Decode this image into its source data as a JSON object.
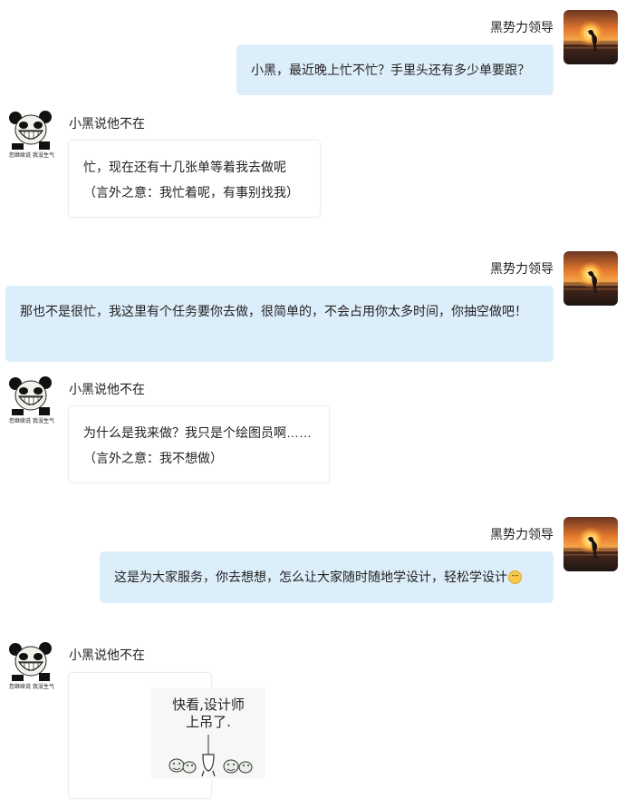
{
  "messages": [
    {
      "sender": "黑势力领导",
      "side": "right",
      "lines": [
        "小黑，最近晚上忙不忙？手里头还有多少单要跟？"
      ]
    },
    {
      "sender": "小黑说他不在",
      "side": "left",
      "lines": [
        "忙，现在还有十几张单等着我去做呢",
        "（言外之意：我忙着呢，有事别找我）"
      ]
    },
    {
      "sender": "黑势力领导",
      "side": "right",
      "text": "那也不是很忙，我这里有个任务要你去做，很简单的，不会占用你太多时间，你抽空做吧！"
    },
    {
      "sender": "小黑说他不在",
      "side": "left",
      "lines": [
        "为什么是我来做？我只是个绘图员啊……",
        "（言外之意：我不想做）"
      ]
    },
    {
      "sender": "黑势力领导",
      "side": "right",
      "text": "这是为大家服务，你去想想，怎么让大家随时随地学设计，轻松学设计",
      "emoji": "smile-emoji"
    },
    {
      "sender": "小黑说他不在",
      "side": "left",
      "sticker": {
        "line1": "快看,设计师",
        "line2": "上吊了."
      }
    }
  ],
  "avatars": {
    "leader": "sunset-heron-avatar",
    "xiaohei": "laughing-panda-avatar",
    "xiaohei_caption": "您继续说 我没生气"
  },
  "colors": {
    "blue_bubble": "#ddeefb",
    "white_bubble": "#ffffff",
    "text": "#222222"
  }
}
